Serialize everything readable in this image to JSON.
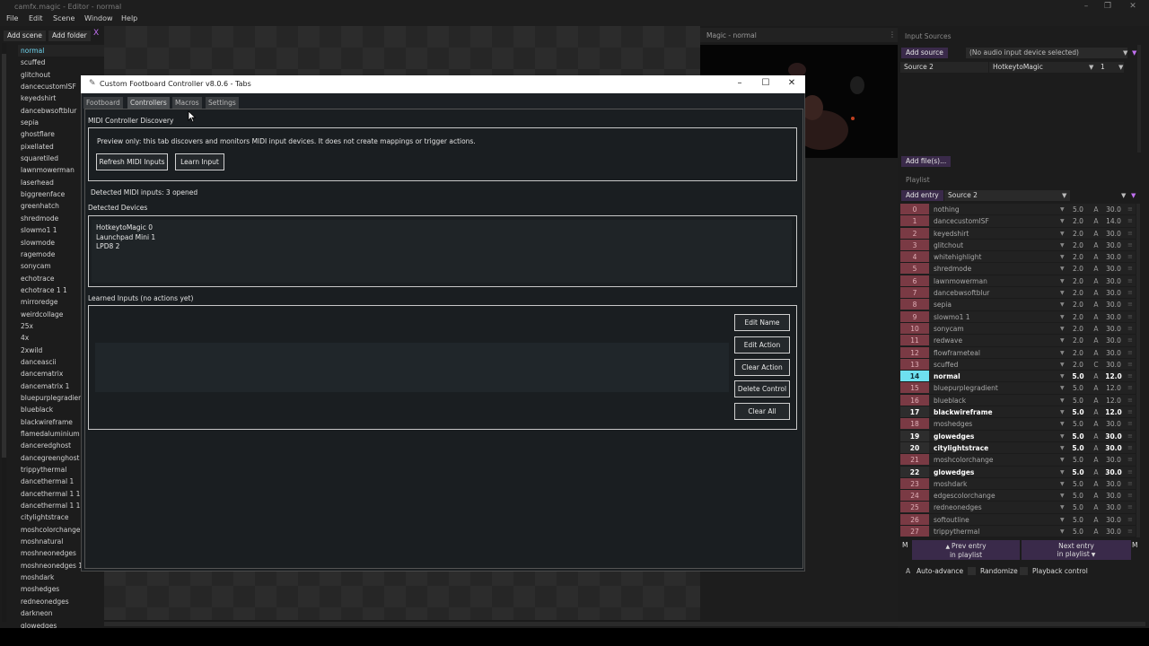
{
  "app": {
    "title": "camfx.magic - Editor - normal",
    "window_controls": [
      "–",
      "❐",
      "✕"
    ]
  },
  "menu": [
    "File",
    "Edit",
    "Scene",
    "Window",
    "Help"
  ],
  "scene_panel": {
    "add_scene": "Add scene",
    "add_folder": "Add folder",
    "close": "X",
    "selected": "normal",
    "scenes": [
      "normal",
      "scuffed",
      "glitchout",
      "dancecustomISF",
      "keyedshirt",
      "dancebwsoftblur",
      "sepia",
      "ghostflare",
      "pixellated",
      "squaretiled",
      "lawnmowerman",
      "laserhead",
      "biggreenface",
      "greenhatch",
      "shredmode",
      "slowmo1 1",
      "slowmode",
      "ragemode",
      "sonycam",
      "echotrace",
      "echotrace 1 1",
      "mirroredge",
      "weirdcollage",
      "25x",
      "4x",
      "2xwild",
      "danceascii",
      "dancematrix",
      "dancematrix 1",
      "bluepurplegradient",
      "blueblack",
      "blackwireframe",
      "flamedaluminium",
      "danceredghost",
      "dancegreenghost",
      "trippythermal",
      "dancethermal 1",
      "dancethermal 1 1",
      "dancethermal 1 1",
      "citylightstrace",
      "moshcolorchange",
      "moshnatural",
      "moshneonedges",
      "moshneonedges 1",
      "moshdark",
      "moshedges",
      "redneonedges",
      "darkneon",
      "glowedges"
    ]
  },
  "preview": {
    "title": "Magic - normal",
    "menu_icon": "⋮"
  },
  "input_sources": {
    "label": "Input Sources",
    "add_source": "Add source",
    "audio_device": "(No audio input device selected)",
    "source_name": "Source 2",
    "source_input": "HotkeytoMagic",
    "source_channel": "1",
    "add_files": "Add file(s)..."
  },
  "playlist": {
    "label": "Playlist",
    "add_entry": "Add entry",
    "source": "Source 2",
    "entries": [
      {
        "idx": "0",
        "name": "nothing",
        "dur": "5.0",
        "mode": "A",
        "len": "30.0",
        "style": "dim"
      },
      {
        "idx": "1",
        "name": "dancecustomISF",
        "dur": "2.0",
        "mode": "A",
        "len": "14.0",
        "style": "dim"
      },
      {
        "idx": "2",
        "name": "keyedshirt",
        "dur": "2.0",
        "mode": "A",
        "len": "30.0",
        "style": "dim"
      },
      {
        "idx": "3",
        "name": "glitchout",
        "dur": "2.0",
        "mode": "A",
        "len": "30.0",
        "style": "dim"
      },
      {
        "idx": "4",
        "name": "whitehighlight",
        "dur": "2.0",
        "mode": "A",
        "len": "30.0",
        "style": "dim"
      },
      {
        "idx": "5",
        "name": "shredmode",
        "dur": "2.0",
        "mode": "A",
        "len": "30.0",
        "style": "dim"
      },
      {
        "idx": "6",
        "name": "lawnmowerman",
        "dur": "2.0",
        "mode": "A",
        "len": "30.0",
        "style": "dim"
      },
      {
        "idx": "7",
        "name": "dancebwsoftblur",
        "dur": "2.0",
        "mode": "A",
        "len": "30.0",
        "style": "dim"
      },
      {
        "idx": "8",
        "name": "sepia",
        "dur": "2.0",
        "mode": "A",
        "len": "30.0",
        "style": "dim"
      },
      {
        "idx": "9",
        "name": "slowmo1 1",
        "dur": "2.0",
        "mode": "A",
        "len": "30.0",
        "style": "dim"
      },
      {
        "idx": "10",
        "name": "sonycam",
        "dur": "2.0",
        "mode": "A",
        "len": "30.0",
        "style": "dim"
      },
      {
        "idx": "11",
        "name": "redwave",
        "dur": "2.0",
        "mode": "A",
        "len": "30.0",
        "style": "dim"
      },
      {
        "idx": "12",
        "name": "flowframeteal",
        "dur": "2.0",
        "mode": "A",
        "len": "30.0",
        "style": "dim"
      },
      {
        "idx": "13",
        "name": "scuffed",
        "dur": "2.0",
        "mode": "C",
        "len": "30.0",
        "style": "dim"
      },
      {
        "idx": "14",
        "name": "normal",
        "dur": "5.0",
        "mode": "A",
        "len": "12.0",
        "style": "cur"
      },
      {
        "idx": "15",
        "name": "bluepurplegradient",
        "dur": "5.0",
        "mode": "A",
        "len": "12.0",
        "style": "dim"
      },
      {
        "idx": "16",
        "name": "blueblack",
        "dur": "5.0",
        "mode": "A",
        "len": "12.0",
        "style": "dim"
      },
      {
        "idx": "17",
        "name": "blackwireframe",
        "dur": "5.0",
        "mode": "A",
        "len": "12.0",
        "style": "bold"
      },
      {
        "idx": "18",
        "name": "moshedges",
        "dur": "5.0",
        "mode": "A",
        "len": "30.0",
        "style": "dim"
      },
      {
        "idx": "19",
        "name": "glowedges",
        "dur": "5.0",
        "mode": "A",
        "len": "30.0",
        "style": "bold"
      },
      {
        "idx": "20",
        "name": "citylightstrace",
        "dur": "5.0",
        "mode": "A",
        "len": "30.0",
        "style": "bold"
      },
      {
        "idx": "21",
        "name": "moshcolorchange",
        "dur": "5.0",
        "mode": "A",
        "len": "30.0",
        "style": "dim"
      },
      {
        "idx": "22",
        "name": "glowedges",
        "dur": "5.0",
        "mode": "A",
        "len": "30.0",
        "style": "bold"
      },
      {
        "idx": "23",
        "name": "moshdark",
        "dur": "5.0",
        "mode": "A",
        "len": "30.0",
        "style": "dim"
      },
      {
        "idx": "24",
        "name": "edgescolorchange",
        "dur": "5.0",
        "mode": "A",
        "len": "30.0",
        "style": "dim"
      },
      {
        "idx": "25",
        "name": "redneonedges",
        "dur": "5.0",
        "mode": "A",
        "len": "30.0",
        "style": "dim"
      },
      {
        "idx": "26",
        "name": "softoutline",
        "dur": "5.0",
        "mode": "A",
        "len": "30.0",
        "style": "dim"
      },
      {
        "idx": "27",
        "name": "trippythermal",
        "dur": "5.0",
        "mode": "A",
        "len": "30.0",
        "style": "dim"
      }
    ],
    "prev_label_1": "Prev entry",
    "prev_label_2": "in playlist",
    "next_label_1": "Next entry",
    "next_label_2": "in playlist",
    "m_left": "M",
    "m_right": "M",
    "auto_advance_key": "A",
    "auto_advance": "Auto-advance",
    "randomize": "Randomize",
    "playback_control": "Playback control"
  },
  "dialog": {
    "title": "Custom Footboard Controller v8.0.6 - Tabs",
    "tabs": [
      "Footboard",
      "Controllers",
      "Macros",
      "Settings"
    ],
    "active_tab": "Controllers",
    "section_title": "MIDI Controller Discovery",
    "info_text": "Preview only: this tab discovers and monitors MIDI input devices. It does not create mappings or trigger actions.",
    "refresh_button": "Refresh MIDI Inputs",
    "learn_button": "Learn Input",
    "detected_status": "Detected MIDI inputs: 3 opened",
    "devices_label": "Detected Devices",
    "devices": [
      "HotkeytoMagic 0",
      "Launchpad Mini 1",
      "LPD8 2"
    ],
    "learned_label": "Learned Inputs (no actions yet)",
    "actions": [
      "Edit Name",
      "Edit Action",
      "Clear Action",
      "Delete Control",
      "Clear All"
    ]
  },
  "colors": {
    "accent_purple": "#3a2a4a",
    "current_entry": "#6ee0f0",
    "entry_red": "#b04050",
    "selected_scene": "#6fd6f0"
  }
}
